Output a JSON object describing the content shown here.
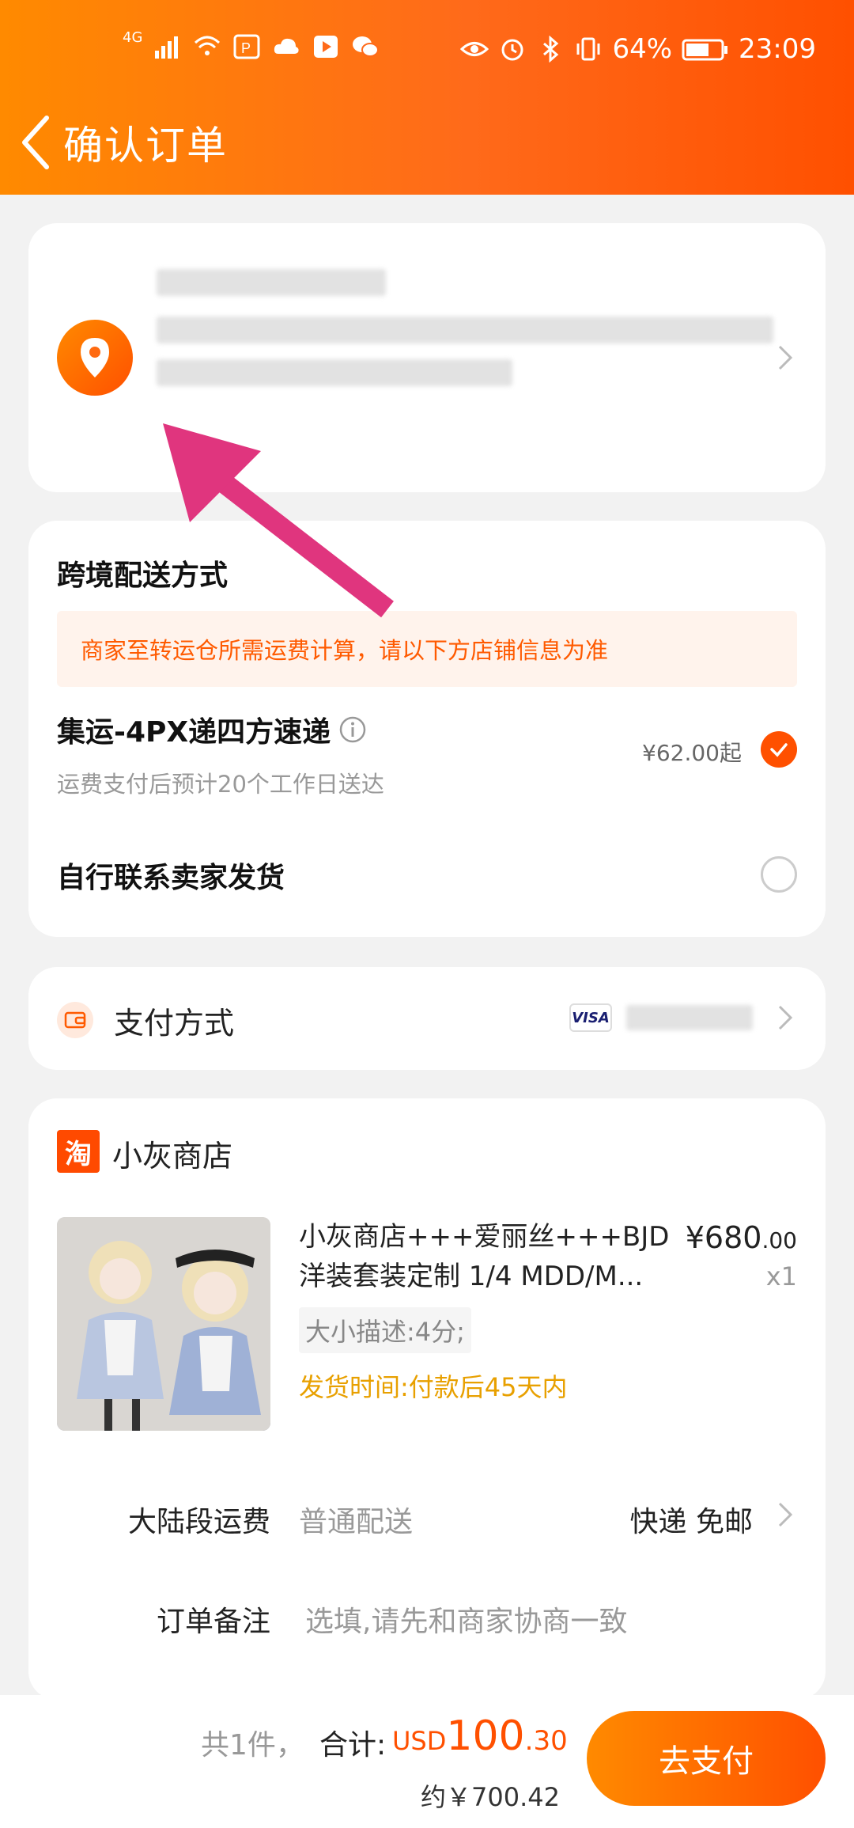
{
  "status_bar": {
    "network": "4G",
    "battery_percent": "64%",
    "time": "23:09",
    "icons": [
      "signal-icon",
      "wifi-icon",
      "app-icon",
      "cloud-icon",
      "play-icon",
      "wechat-icon",
      "eye-icon",
      "alarm-icon",
      "bluetooth-icon",
      "vibrate-icon",
      "battery-icon"
    ]
  },
  "header": {
    "title": "确认订单"
  },
  "shipping": {
    "title": "跨境配送方式",
    "notice": "商家至转运仓所需运费计算，请以下方店铺信息为准",
    "options": [
      {
        "title": "集运-4PX递四方速递",
        "subtitle": "运费支付后预计20个工作日送达",
        "price": "¥62.00起",
        "selected": true
      },
      {
        "title": "自行联系卖家发货",
        "selected": false
      }
    ]
  },
  "payment": {
    "label": "支付方式",
    "card_brand": "VISA"
  },
  "store": {
    "platform_badge": "淘",
    "name": "小灰商店",
    "product": {
      "title": "小灰商店+++爱丽丝+++BJD洋装套装定制 1/4 MDD/M...",
      "price_int": "¥680",
      "price_dec": ".00",
      "quantity": "x1",
      "spec": "大小描述:4分;",
      "ship_time": "发货时间:付款后45天内"
    },
    "mainland_fee": {
      "label": "大陆段运费",
      "value": "普通配送",
      "right": "快递 免邮"
    },
    "remark": {
      "label": "订单备注",
      "placeholder": "选填,请先和商家协商一致"
    }
  },
  "bottom_bar": {
    "count_text": "共1件，",
    "total_label": "合计:",
    "currency": "USD",
    "total_int": "100",
    "total_dec": ".30",
    "approx": "约￥700.42",
    "pay_button": "去支付"
  },
  "colors": {
    "accent": "#ff5000",
    "accent_light": "#ff8a00",
    "annotation_arrow": "#e0357e",
    "ship_time": "#e8a000"
  }
}
